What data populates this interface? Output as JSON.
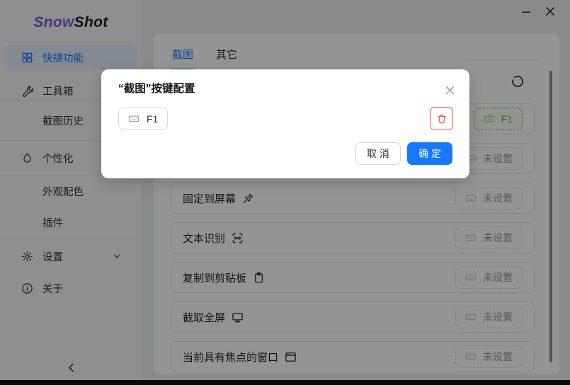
{
  "colors": {
    "accent": "#1677ff",
    "danger": "#ff4d4f",
    "success": "#52c41a",
    "brand_purple": "#7c5cd6"
  },
  "window": {
    "controls": [
      {
        "name": "minimize-button",
        "icon": "minimize-icon"
      },
      {
        "name": "close-button",
        "icon": "close-icon"
      }
    ]
  },
  "brand": {
    "name_primary": "Snow",
    "name_secondary": "Shot"
  },
  "sidebar": {
    "items": [
      {
        "name": "quick-functions",
        "label": "快捷功能",
        "icon": "grid-icon",
        "selected": true
      },
      {
        "name": "toolbox",
        "label": "工具箱",
        "icon": "wrench-icon"
      },
      {
        "name": "screenshot-history",
        "label": "截图历史",
        "icon": null
      },
      {
        "name": "personalization",
        "label": "个性化",
        "icon": "palette-icon"
      },
      {
        "name": "appearance-colors",
        "label": "外观配色",
        "icon": null
      },
      {
        "name": "plugins",
        "label": "插件",
        "icon": null
      },
      {
        "name": "settings",
        "label": "设置",
        "icon": "gear-icon",
        "expand_icon": "chevron-down-icon"
      },
      {
        "name": "about",
        "label": "关于",
        "icon": "info-icon"
      }
    ],
    "collapse_icon": "chevron-left-icon"
  },
  "main": {
    "tabs": [
      {
        "name": "tab-screenshot",
        "label": "截图",
        "active": true
      },
      {
        "name": "tab-other",
        "label": "其它",
        "active": false
      }
    ],
    "header_icon": "sync-icon",
    "rows": [
      {
        "name": "row-hidden-1",
        "label": "",
        "icon": null,
        "shortcut": "F1",
        "configured": true
      },
      {
        "name": "row-hidden-2",
        "label": "",
        "icon": null,
        "shortcut": "未设置",
        "configured": false
      },
      {
        "name": "pin-to-screen",
        "label": "固定到屏幕",
        "icon": "pin-icon",
        "shortcut": "未设置",
        "configured": false
      },
      {
        "name": "text-recognition",
        "label": "文本识别",
        "icon": "ocr-icon",
        "shortcut": "未设置",
        "configured": false
      },
      {
        "name": "copy-to-clipboard",
        "label": "复制到剪贴板",
        "icon": "clipboard-icon",
        "shortcut": "未设置",
        "configured": false
      },
      {
        "name": "capture-fullscreen",
        "label": "截取全屏",
        "icon": "monitor-icon",
        "shortcut": "未设置",
        "configured": false
      },
      {
        "name": "focused-window",
        "label": "当前具有焦点的窗口",
        "icon": "window-icon",
        "shortcut": "未设置",
        "configured": false
      }
    ],
    "badge_icon": "keyboard-icon"
  },
  "modal": {
    "title": "“截图”按键配置",
    "close_icon": "close-icon",
    "key_button": {
      "icon": "keyboard-icon",
      "label": "F1"
    },
    "delete_icon": "trash-icon",
    "cancel_label": "取 消",
    "confirm_label": "确 定"
  }
}
